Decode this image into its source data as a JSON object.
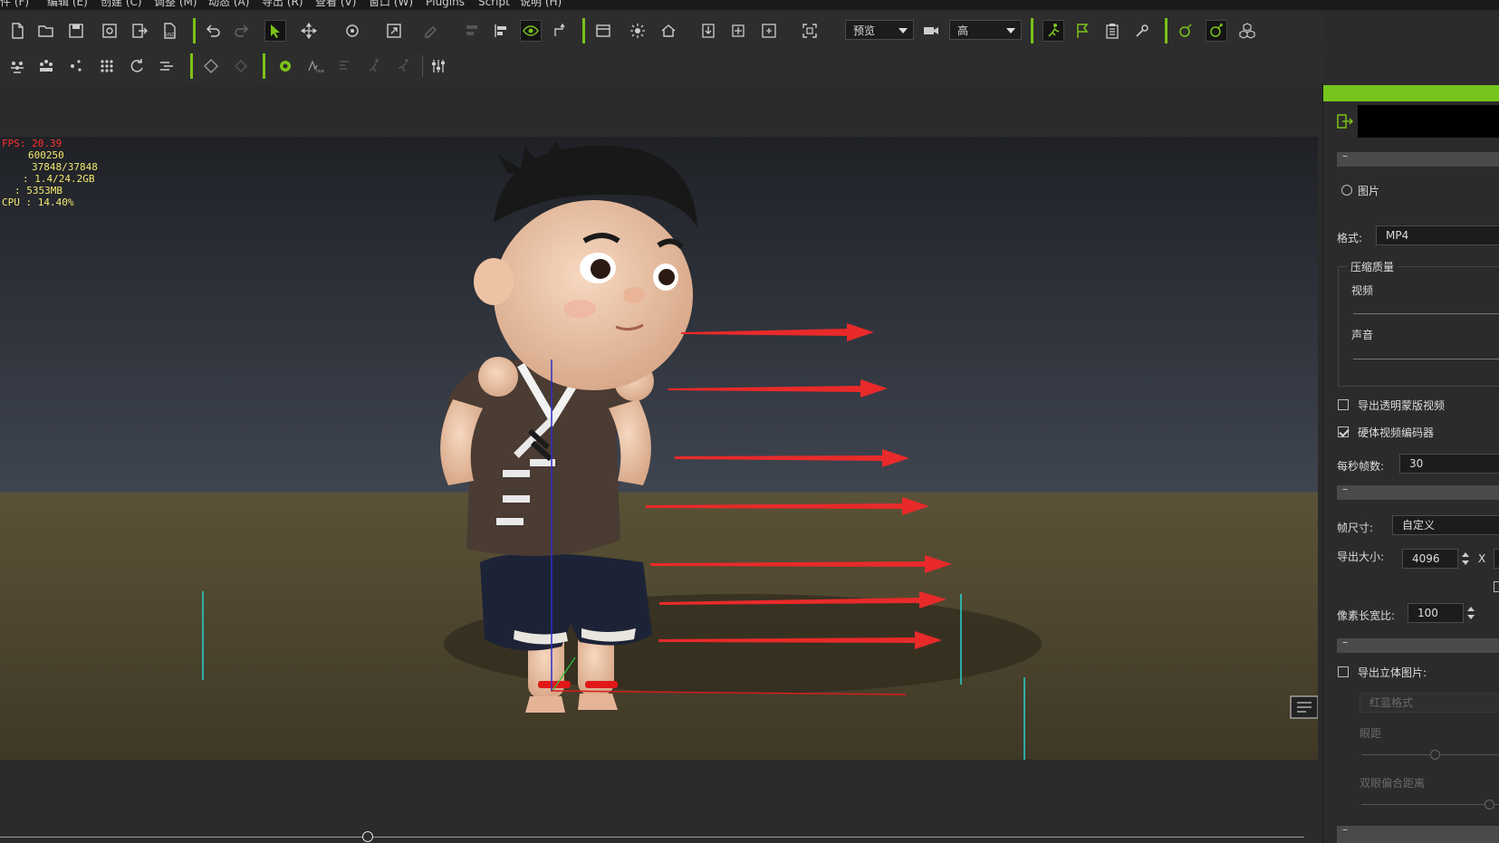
{
  "menu": [
    "件 (F)",
    "编辑 (E)",
    "创建 (C)",
    "调整 (M)",
    "动态 (A)",
    "导出 (R)",
    "查看 (V)",
    "窗口 (W)",
    "Plugins",
    "Script",
    "说明 (H)"
  ],
  "toolbar": {
    "preview_combo": "预览",
    "quality_combo": "高"
  },
  "stats": {
    "fps": "FPS: 20.39",
    "line2": "600250",
    "line3": "37848/37848",
    "line4": ": 1.4/24.2GB",
    "line5": ": 5353MB",
    "cpu": "CPU : 14.40%"
  },
  "panel": {
    "collapse_symbol": "–",
    "image_radio": "图片",
    "format_label": "格式:",
    "format_value": "MP4",
    "quality_group": "压缩质量",
    "video_label": "视频",
    "audio_label": "声音",
    "export_alpha": "导出透明蒙版视频",
    "hw_encoder": "硬体视频编码器",
    "fps_label": "每秒帧数:",
    "fps_value": "30",
    "frame_size_label": "帧尺寸:",
    "frame_size_value": "自定义",
    "export_size_label": "导出大小:",
    "export_width": "4096",
    "x_label": "X",
    "pixel_ratio_label": "像素长宽比:",
    "pixel_ratio_value": "100",
    "stereo_label": "导出立体图片:",
    "stereo_format": "红蓝格式",
    "eye_dist": "眼距",
    "eye_offset": "双眼偏合距离"
  },
  "colors": {
    "accent": "#7cc21a",
    "arrow": "#e82a2a",
    "fps": "#ff3030",
    "stats": "#f2e970"
  }
}
